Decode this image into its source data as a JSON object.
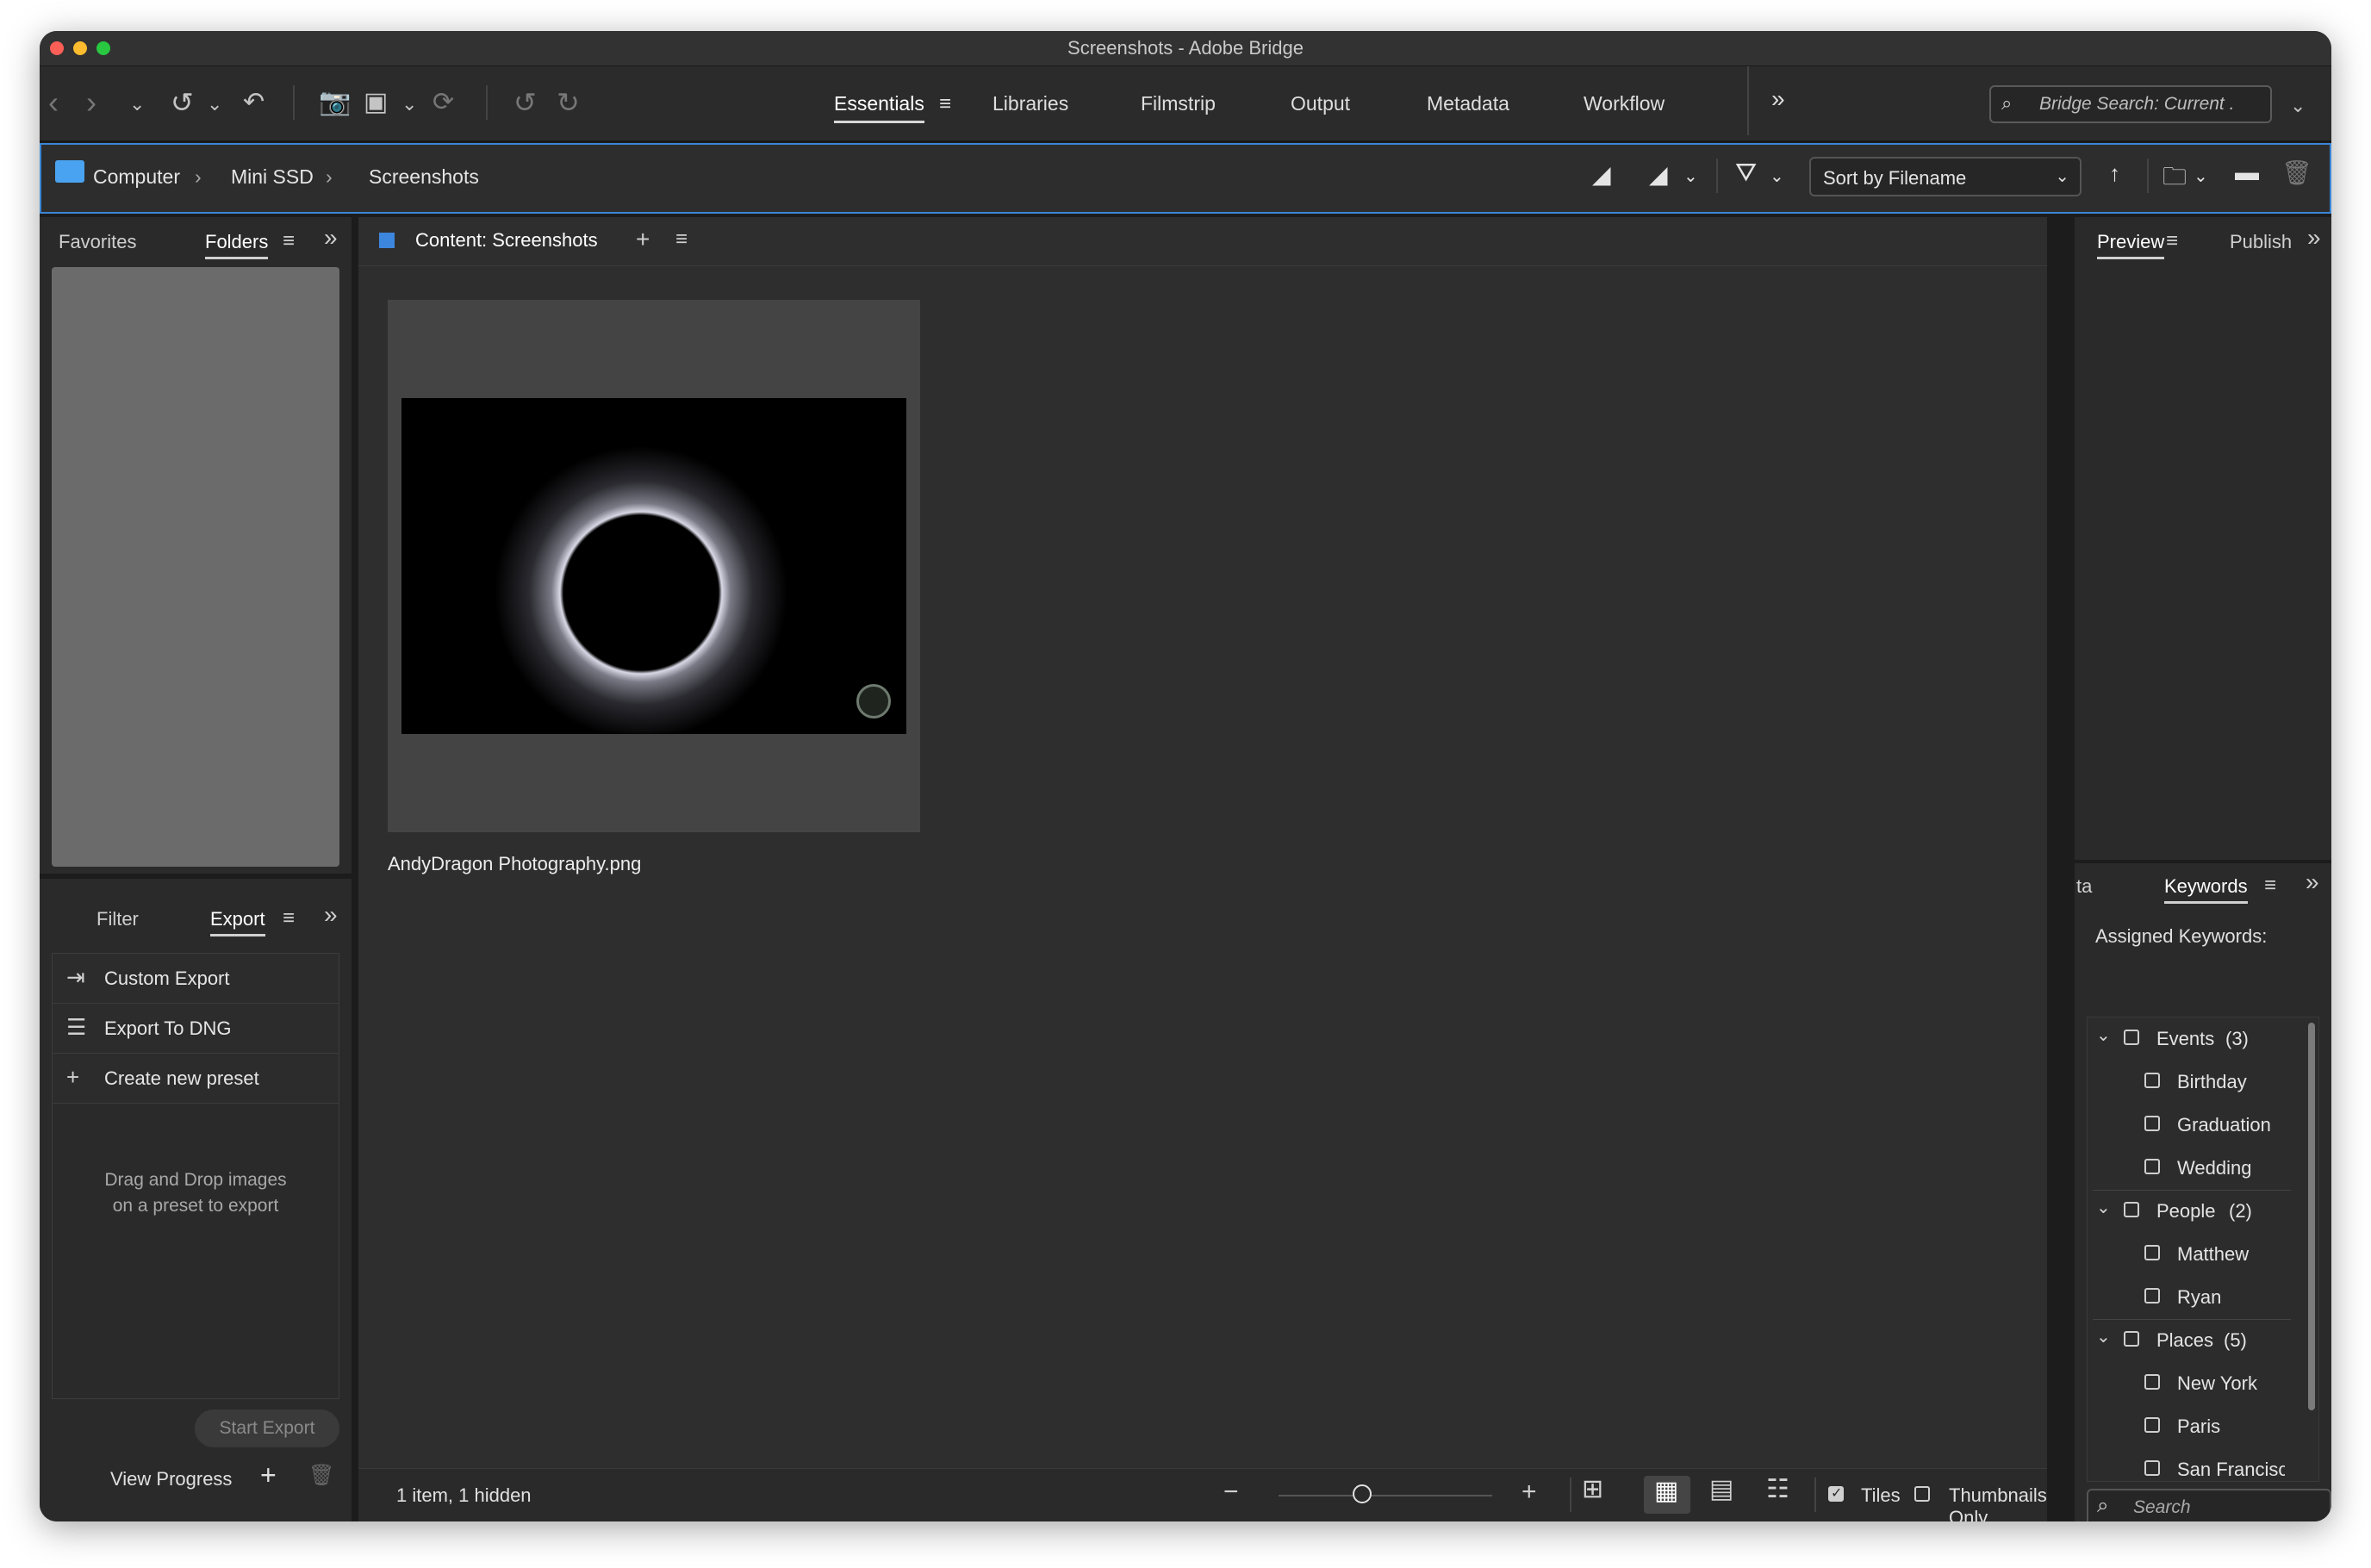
{
  "window": {
    "title": "Screenshots - Adobe Bridge",
    "traffic_lights": [
      "#fe5f57",
      "#febc2e",
      "#28c840"
    ]
  },
  "toolbar": {
    "workspace_tabs": [
      "Essentials",
      "Libraries",
      "Filmstrip",
      "Output",
      "Metadata",
      "Workflow"
    ],
    "active_workspace": "Essentials",
    "search_placeholder": "Bridge Search: Current ."
  },
  "path_bar": {
    "breadcrumbs": [
      "Computer",
      "Mini SSD",
      "Screenshots"
    ],
    "sort_label": "Sort by Filename"
  },
  "left_top_panel": {
    "tabs": [
      "Favorites",
      "Folders"
    ],
    "active_tab": "Folders"
  },
  "left_bottom_panel": {
    "tabs": [
      "Filter",
      "Export"
    ],
    "active_tab": "Export",
    "items": [
      {
        "label": "Custom Export",
        "icon": "export-icon"
      },
      {
        "label": "Export To DNG",
        "icon": "list-icon"
      },
      {
        "label": "Create new preset",
        "icon": "plus-icon"
      }
    ],
    "drop_hint": "Drag and Drop images on a preset to export",
    "start_export_label": "Start Export",
    "view_progress_label": "View Progress"
  },
  "content": {
    "header": "Content: Screenshots",
    "header_color": "#3d86dd",
    "thumbnail_name": "AndyDragon Photography.png",
    "status": "1 item, 1 hidden",
    "zoom_level": 0.39,
    "tiles_label": "Tiles",
    "tiles_checked": true,
    "thumbnails_only_label": "Thumbnails Only",
    "thumbnails_only_checked": false
  },
  "right_top_panel": {
    "tabs": [
      "Preview",
      "Publish"
    ],
    "active_tab": "Preview"
  },
  "keywords_panel": {
    "tab_fragment": "ta",
    "tab": "Keywords",
    "assigned_label": "Assigned Keywords:",
    "groups": [
      {
        "name": "Events",
        "count": "(3)",
        "items": [
          "Birthday",
          "Graduation",
          "Wedding"
        ]
      },
      {
        "name": "People",
        "count": "(2)",
        "items": [
          "Matthew",
          "Ryan"
        ]
      },
      {
        "name": "Places",
        "count": "(5)",
        "items": [
          "New York",
          "Paris",
          "San Francisco"
        ]
      }
    ],
    "search_placeholder": "Search"
  },
  "colors": {
    "accent_blue": "#3c86d6",
    "bg": "#1c1c1c",
    "panel": "#2a2a2a"
  }
}
